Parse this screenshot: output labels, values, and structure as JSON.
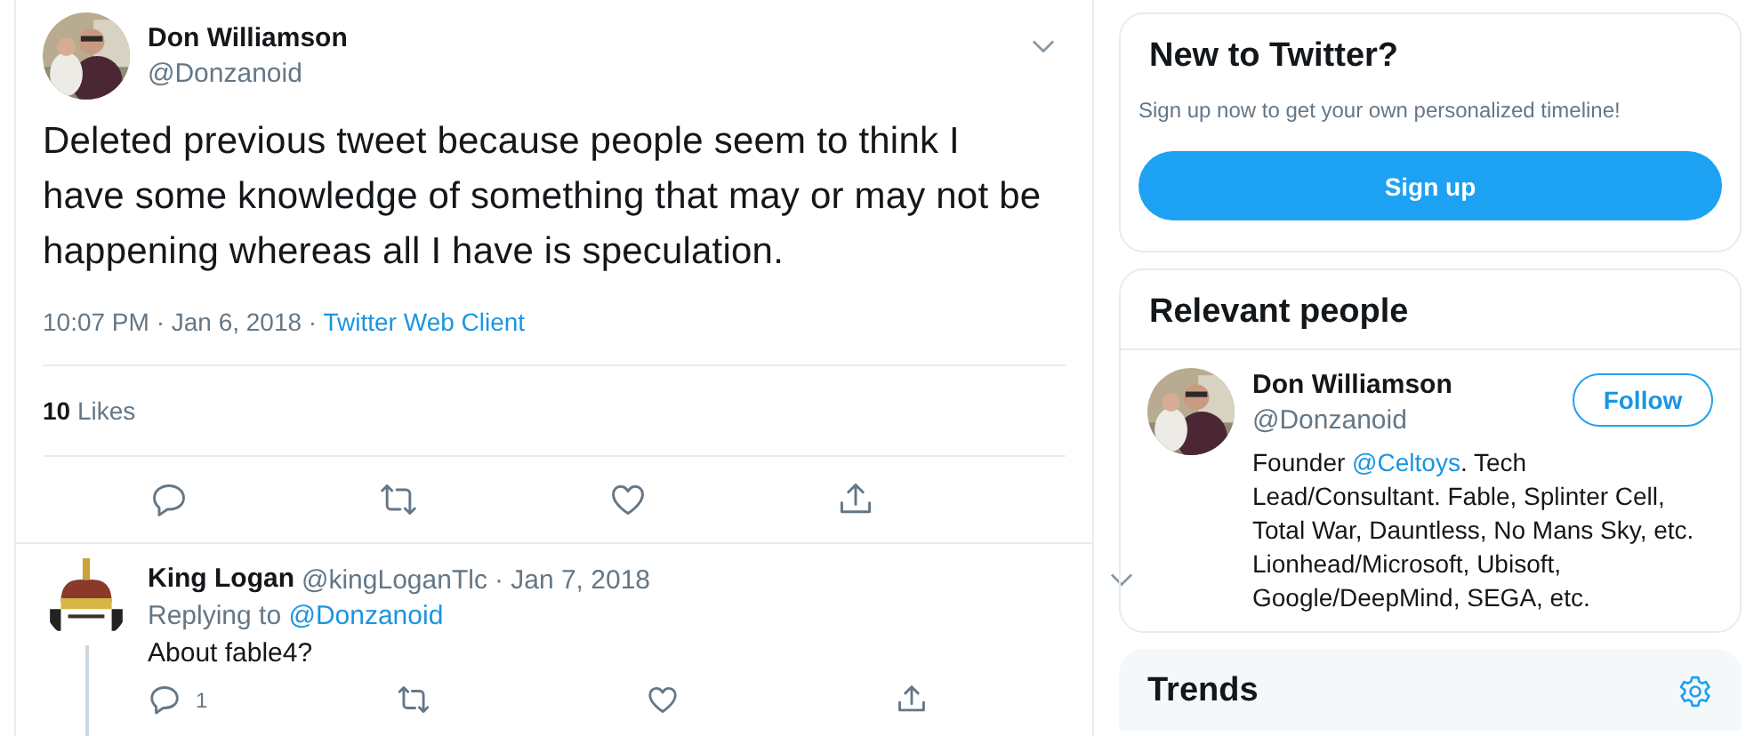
{
  "tweet": {
    "author": {
      "name": "Don Williamson",
      "handle": "@Donzanoid"
    },
    "text": "Deleted previous tweet because people seem to think I have some knowledge of something that may or may not be happening whereas all I have is speculation.",
    "time": "10:07 PM · Jan 6, 2018 · ",
    "client": "Twitter Web Client",
    "likes": "**10** Likes",
    "actions": [
      {
        "kind": "reply"
      },
      {
        "kind": "retweet"
      },
      {
        "kind": "like"
      },
      {
        "kind": "share"
      }
    ]
  },
  "reply": {
    "name": "King Logan",
    "handle": "@kingLoganTlc",
    "date": "· Jan 7, 2018",
    "replying_label": "Replying to ",
    "replying_to": "@Donzanoid",
    "text": "About fable4?",
    "actions": [
      {
        "kind": "reply",
        "count": "1"
      },
      {
        "kind": "retweet"
      },
      {
        "kind": "like"
      },
      {
        "kind": "share"
      }
    ]
  },
  "signup_card": {
    "title": "New to Twitter?",
    "subtitle": "Sign up now to get your own personalized timeline!",
    "button": "Sign up"
  },
  "people_card": {
    "title": "Relevant people",
    "person": {
      "name": "Don Williamson",
      "handle": "@Donzanoid",
      "follow": "Follow",
      "bio": [
        {
          "kind": "text",
          "text": "Founder "
        },
        {
          "kind": "link",
          "text": "@Celtoys"
        },
        {
          "kind": "text",
          "text": ". Tech Lead/Consultant. Fable, Splinter Cell, Total War, Dauntless, No Mans Sky, etc. Lionhead/Microsoft, Ubisoft, Google/DeepMind, SEGA, etc."
        }
      ]
    }
  },
  "trends": {
    "title": "Trends"
  }
}
